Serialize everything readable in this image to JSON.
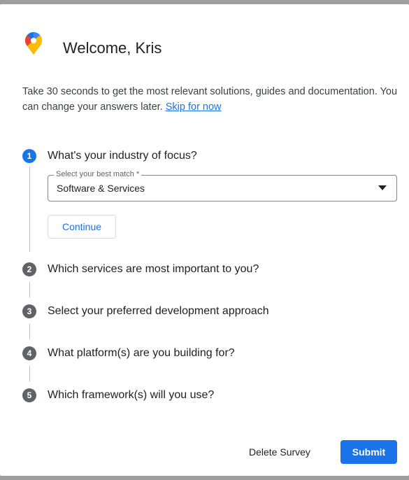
{
  "dialog": {
    "title": "Welcome, Kris",
    "intro_text": "Take 30 seconds to get the most relevant solutions, guides and documentation. You can change your answers later.",
    "skip_link": "Skip for now"
  },
  "steps": [
    {
      "number": "1",
      "label": "What's your industry of focus?",
      "active": true
    },
    {
      "number": "2",
      "label": "Which services are most important to you?"
    },
    {
      "number": "3",
      "label": "Select your preferred development approach"
    },
    {
      "number": "4",
      "label": "What platform(s) are you building for?"
    },
    {
      "number": "5",
      "label": "Which framework(s) will you use?"
    }
  ],
  "industry_select": {
    "label": "Select your best match *",
    "value": "Software & Services"
  },
  "buttons": {
    "continue": "Continue",
    "delete": "Delete Survey",
    "submit": "Submit"
  },
  "colors": {
    "accent": "#1a73e8",
    "step_inactive": "#5f6368"
  }
}
